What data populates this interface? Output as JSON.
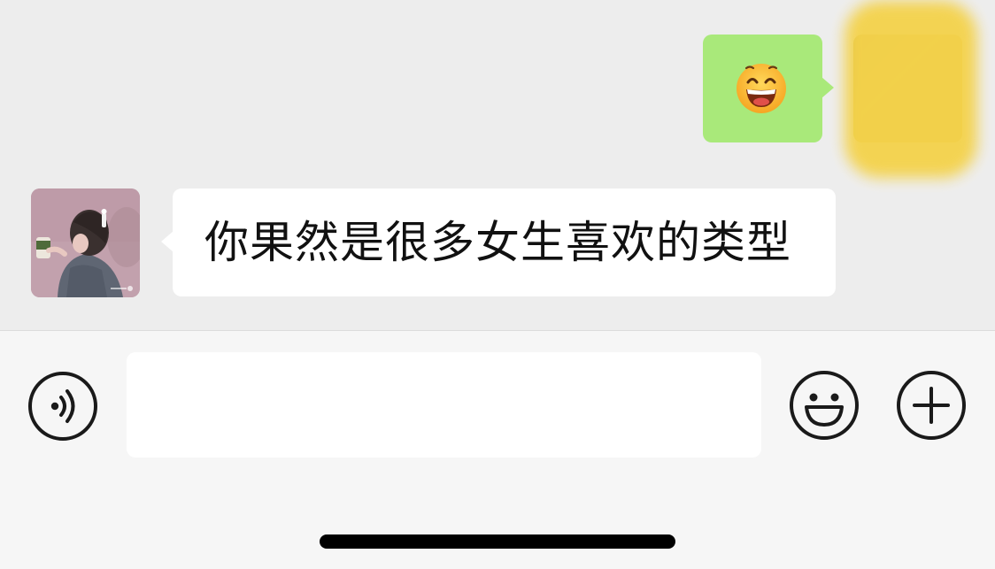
{
  "messages": [
    {
      "direction": "outgoing",
      "content_type": "emoji",
      "emoji": "grinning-face-icon",
      "bubble_color": "#a9e97a",
      "avatar": "blurred-avatar"
    },
    {
      "direction": "incoming",
      "content_type": "text",
      "text": "你果然是很多女生喜欢的类型",
      "bubble_color": "#ffffff",
      "avatar": "girl-illustration-avatar"
    }
  ],
  "input_bar": {
    "voice_icon": "voice-icon",
    "message_value": "",
    "emoji_icon": "emoji-icon",
    "more_icon": "plus-icon"
  },
  "colors": {
    "chat_background": "#ededed",
    "input_bar_background": "#f6f6f6",
    "outgoing_bubble": "#a9e97a",
    "incoming_bubble": "#ffffff"
  }
}
